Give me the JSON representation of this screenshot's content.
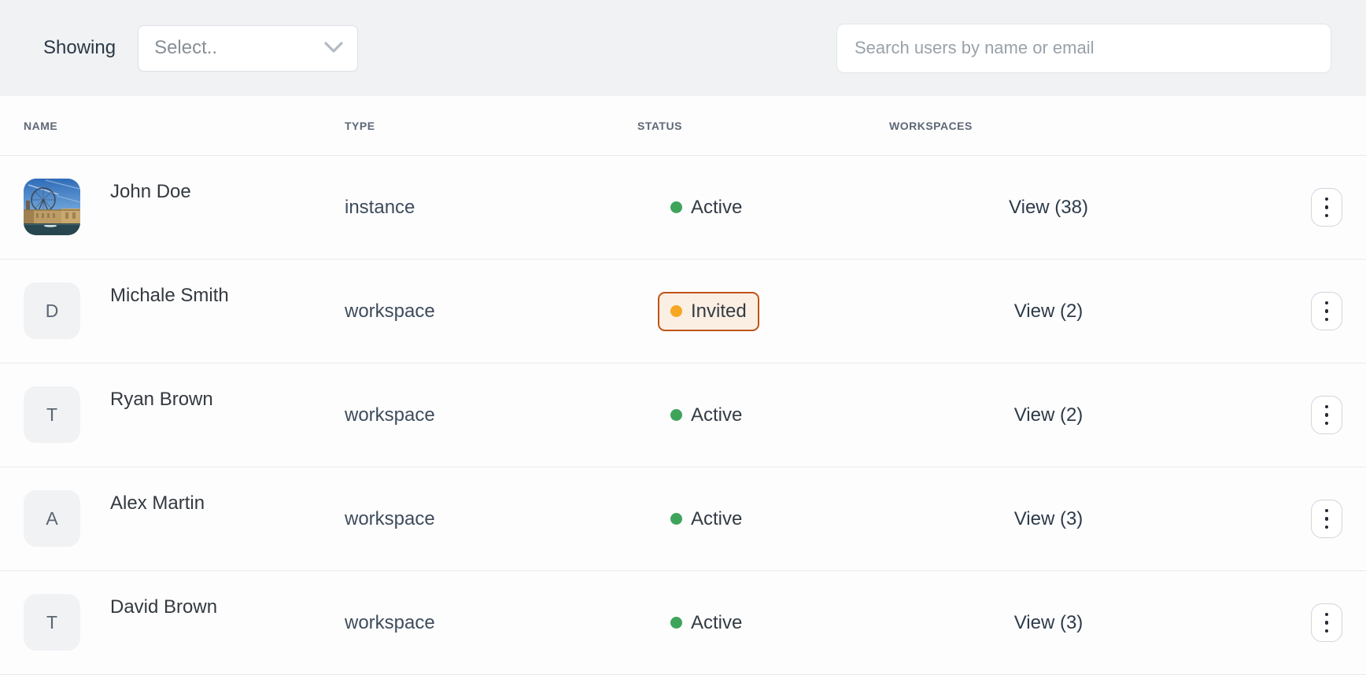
{
  "toolbar": {
    "showing_label": "Showing",
    "filter_select": {
      "value": "Select.."
    },
    "search": {
      "placeholder": "Search users by name or email"
    }
  },
  "table": {
    "columns": [
      "NAME",
      "TYPE",
      "STATUS",
      "WORKSPACES"
    ],
    "rows": [
      {
        "name": "John Doe",
        "avatar": {
          "kind": "photo",
          "description": "london-eye-cityscape-photo"
        },
        "type": "instance",
        "status": {
          "label": "Active",
          "state": "active"
        },
        "workspaces": "View (38)"
      },
      {
        "name": "Michale Smith",
        "avatar": {
          "kind": "letter",
          "letter": "D"
        },
        "type": "workspace",
        "status": {
          "label": "Invited",
          "state": "invited"
        },
        "workspaces": "View (2)"
      },
      {
        "name": "Ryan Brown",
        "avatar": {
          "kind": "letter",
          "letter": "T"
        },
        "type": "workspace",
        "status": {
          "label": "Active",
          "state": "active"
        },
        "workspaces": "View (2)"
      },
      {
        "name": "Alex Martin",
        "avatar": {
          "kind": "letter",
          "letter": "A"
        },
        "type": "workspace",
        "status": {
          "label": "Active",
          "state": "active"
        },
        "workspaces": "View (3)"
      },
      {
        "name": "David Brown",
        "avatar": {
          "kind": "letter",
          "letter": "T"
        },
        "type": "workspace",
        "status": {
          "label": "Active",
          "state": "active"
        },
        "workspaces": "View (3)"
      }
    ]
  },
  "icons": {
    "dropdown": "chevron-down-icon",
    "row_actions": "kebab-menu-icon"
  },
  "colors": {
    "topbar_bg": "#f0f2f4",
    "divider": "#e5e8eb",
    "header_text": "#5d6876",
    "active_dot": "#3fa45b",
    "invited_dot": "#f6a623",
    "invited_border": "#c05417",
    "invited_bg": "#fbeee3"
  }
}
